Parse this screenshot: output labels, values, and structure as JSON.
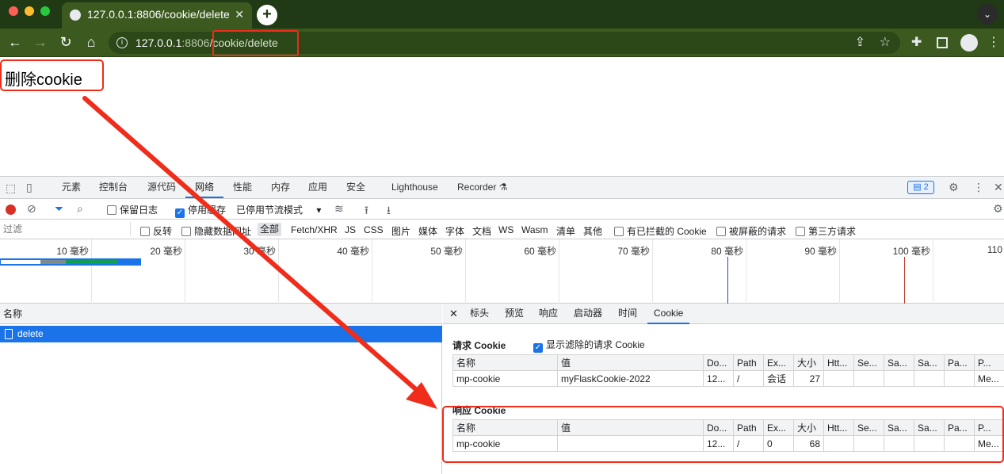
{
  "browser": {
    "tab_title": "127.0.0.1:8806/cookie/delete",
    "url_host": "127.0.0.1",
    "url_port": ":8806",
    "url_path": "/cookie/delete",
    "profile_count": ""
  },
  "page": {
    "heading": "删除cookie"
  },
  "devtools": {
    "tabs": [
      "元素",
      "控制台",
      "源代码",
      "网络",
      "性能",
      "内存",
      "应用",
      "安全",
      "Lighthouse",
      "Recorder ⚗"
    ],
    "selected_tab": "网络",
    "issues_badge": "2",
    "toolbar": {
      "preserve_log": "保留日志",
      "disable_cache": "停用缓存",
      "throttle": "已停用节流模式"
    },
    "filter": {
      "placeholder": "过滤",
      "invert": "反转",
      "hide_data_urls": "隐藏数据网址",
      "types": [
        "全部",
        "Fetch/XHR",
        "JS",
        "CSS",
        "图片",
        "媒体",
        "字体",
        "文档",
        "WS",
        "Wasm",
        "清单",
        "其他"
      ],
      "blocked_cookies": "有已拦截的 Cookie",
      "blocked_requests": "被屏蔽的请求",
      "third_party": "第三方请求"
    },
    "timeline_ticks": [
      "10 毫秒",
      "20 毫秒",
      "30 毫秒",
      "40 毫秒",
      "50 毫秒",
      "60 毫秒",
      "70 毫秒",
      "80 毫秒",
      "90 毫秒",
      "100 毫秒",
      "110"
    ],
    "list": {
      "header": "名称",
      "rows": [
        "delete"
      ]
    },
    "detail": {
      "tabs": [
        "标头",
        "预览",
        "响应",
        "启动器",
        "时间",
        "Cookie"
      ],
      "selected_tab": "Cookie",
      "request_title": "请求 Cookie",
      "show_filtered": "显示滤除的请求 Cookie",
      "response_title": "响应 Cookie",
      "columns": [
        "名称",
        "值",
        "Do...",
        "Path",
        "Ex...",
        "大小",
        "Htt...",
        "Se...",
        "Sa...",
        "Sa...",
        "Pa...",
        "P..."
      ],
      "request_row": [
        "mp-cookie",
        "myFlaskCookie-2022",
        "12...",
        "/",
        "会话",
        "27",
        "",
        "",
        "",
        "",
        "",
        "Me..."
      ],
      "response_row": [
        "mp-cookie",
        "",
        "12...",
        "/",
        "0",
        "68",
        "",
        "",
        "",
        "",
        "",
        "Me..."
      ]
    }
  },
  "colors": {
    "annotation_red": "#f02c1b",
    "accent_blue": "#1a73e8"
  }
}
